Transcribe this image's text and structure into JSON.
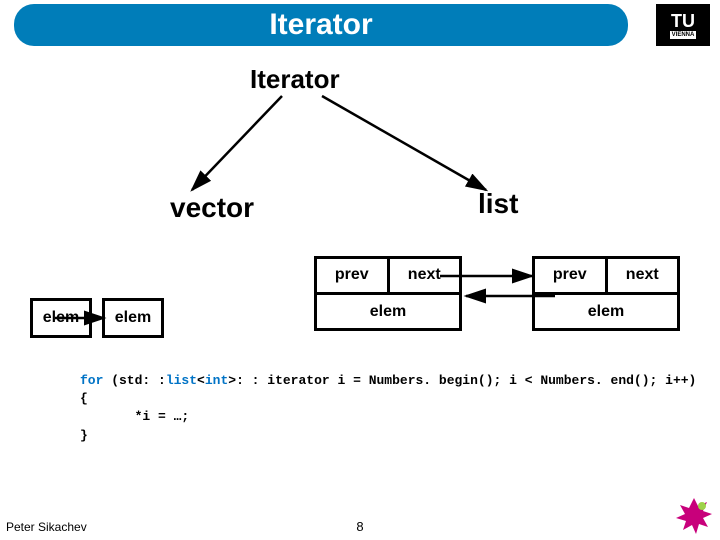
{
  "title": "Iterator",
  "subtitle": "Iterator",
  "logo": {
    "main": "TU",
    "sub": "VIENNA"
  },
  "labels": {
    "vector": "vector",
    "list": "list"
  },
  "vector": {
    "cells": [
      "elem",
      "elem"
    ]
  },
  "list": {
    "nodes": [
      {
        "prev": "prev",
        "next": "next",
        "data": "elem"
      },
      {
        "prev": "prev",
        "next": "next",
        "data": "elem"
      }
    ]
  },
  "code": {
    "line1a": "for",
    "line1b": " (std: :",
    "line1c": "list",
    "line1d": "<",
    "line1e": "int",
    "line1f": ">: : iterator i = Numbers. begin(); i < Numbers. end(); i++)",
    "line2": "{",
    "line3": "       *i = …;",
    "line4": "}"
  },
  "footer": {
    "author": "Peter Sikachev",
    "page": "8"
  }
}
